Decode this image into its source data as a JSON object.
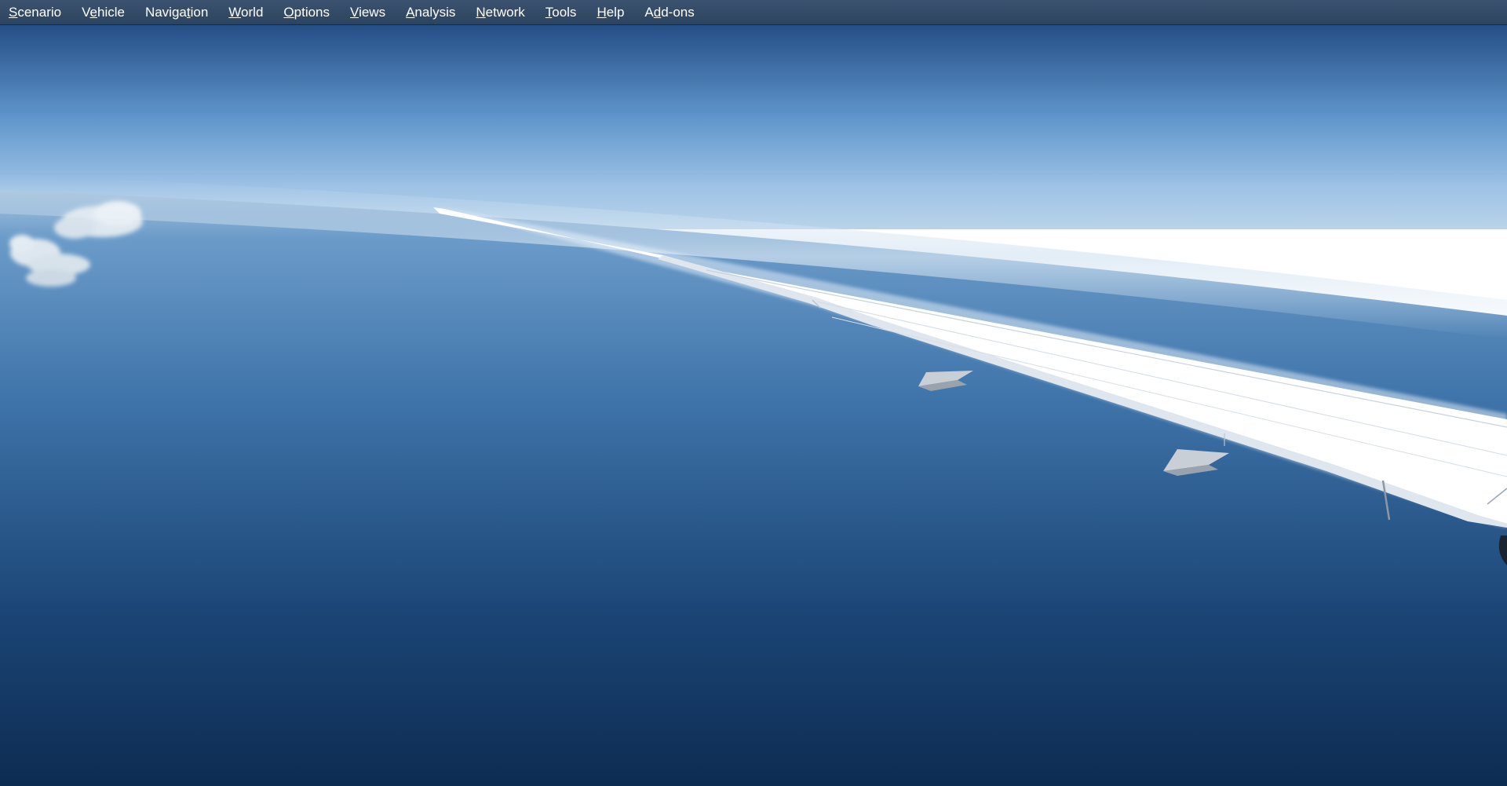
{
  "menubar": {
    "items": [
      {
        "label": "Scenario",
        "ul_index": 0
      },
      {
        "label": "Vehicle",
        "ul_index": 1
      },
      {
        "label": "Navigation",
        "ul_index": 6
      },
      {
        "label": "World",
        "ul_index": 0
      },
      {
        "label": "Options",
        "ul_index": 0
      },
      {
        "label": "Views",
        "ul_index": 0
      },
      {
        "label": "Analysis",
        "ul_index": 0
      },
      {
        "label": "Network",
        "ul_index": 0
      },
      {
        "label": "Tools",
        "ul_index": 0
      },
      {
        "label": "Help",
        "ul_index": 0
      },
      {
        "label": "Add-ons",
        "ul_index": 1
      }
    ]
  },
  "scene": {
    "sky_top_color": "#244f86",
    "horizon_color": "#b9d3ea",
    "ocean_far_color": "#6b9bc9",
    "ocean_near_color": "#0d2c52",
    "wing_color": "#ffffff"
  }
}
